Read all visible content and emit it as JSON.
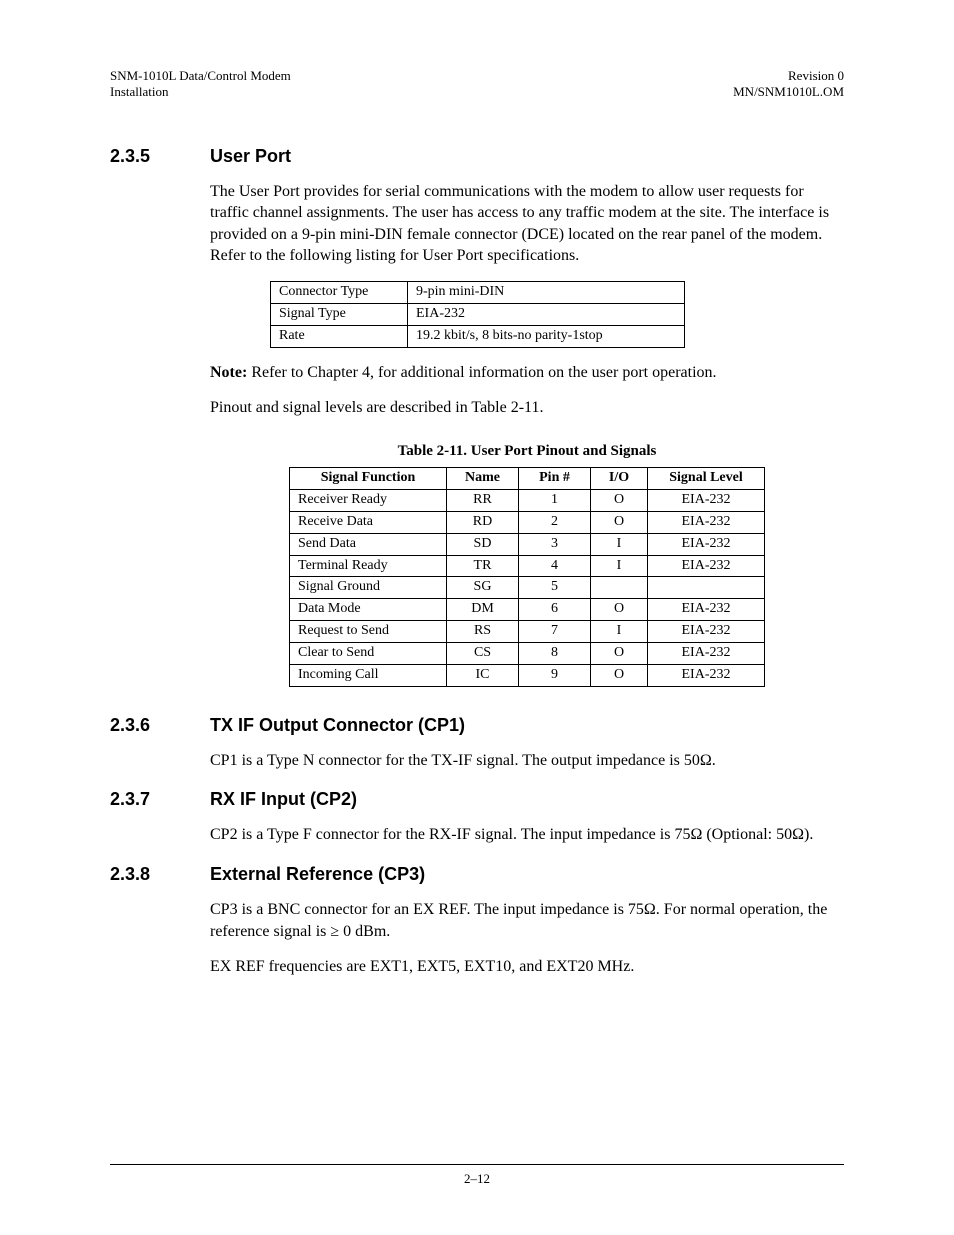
{
  "header": {
    "left1": "SNM-1010L Data/Control Modem",
    "left2": "Installation",
    "right1": "Revision 0",
    "right2": "MN/SNM1010L.OM"
  },
  "s235": {
    "num": "2.3.5",
    "title": "User Port",
    "para": "The User Port provides for serial communications with the modem to allow user requests for traffic channel assignments. The user has access to any traffic modem at the site. The interface is provided on a 9-pin mini-DIN female connector (DCE) located on the rear panel of the modem. Refer to the following listing for User Port specifications.",
    "spec": [
      [
        "Connector Type",
        "9-pin mini-DIN"
      ],
      [
        "Signal Type",
        "EIA-232"
      ],
      [
        "Rate",
        "19.2 kbit/s, 8 bits-no parity-1stop"
      ]
    ],
    "note_b": "Note:",
    "note_t": " Refer to Chapter 4, for additional information on the user port operation.",
    "para2": "Pinout and signal levels are described in Table 2-11.",
    "caption": "Table 2-11.  User Port Pinout and Signals",
    "headers": [
      "Signal Function",
      "Name",
      "Pin #",
      "I/O",
      "Signal Level"
    ],
    "rows": [
      [
        "Receiver Ready",
        "RR",
        "1",
        "O",
        "EIA-232"
      ],
      [
        "Receive Data",
        "RD",
        "2",
        "O",
        "EIA-232"
      ],
      [
        "Send Data",
        "SD",
        "3",
        "I",
        "EIA-232"
      ],
      [
        "Terminal Ready",
        "TR",
        "4",
        "I",
        "EIA-232"
      ],
      [
        "Signal Ground",
        "SG",
        "5",
        "",
        ""
      ],
      [
        "Data Mode",
        "DM",
        "6",
        "O",
        "EIA-232"
      ],
      [
        "Request to Send",
        "RS",
        "7",
        "I",
        "EIA-232"
      ],
      [
        "Clear to Send",
        "CS",
        "8",
        "O",
        "EIA-232"
      ],
      [
        "Incoming Call",
        "IC",
        "9",
        "O",
        "EIA-232"
      ]
    ]
  },
  "s236": {
    "num": "2.3.6",
    "title": "TX IF Output Connector (CP1)",
    "para": "CP1 is a Type N connector for the TX-IF signal. The output impedance is 50Ω."
  },
  "s237": {
    "num": "2.3.7",
    "title": "RX IF Input (CP2)",
    "para": "CP2 is a Type F connector for the RX-IF signal. The input impedance is 75Ω (Optional: 50Ω)."
  },
  "s238": {
    "num": "2.3.8",
    "title": "External Reference (CP3)",
    "para1": "CP3 is a BNC connector for an EX REF. The input impedance is 75Ω. For normal operation, the reference signal is ≥ 0 dBm.",
    "para2": "EX REF frequencies are EXT1, EXT5, EXT10, and EXT20 MHz."
  },
  "footer": {
    "page": "2–12"
  }
}
